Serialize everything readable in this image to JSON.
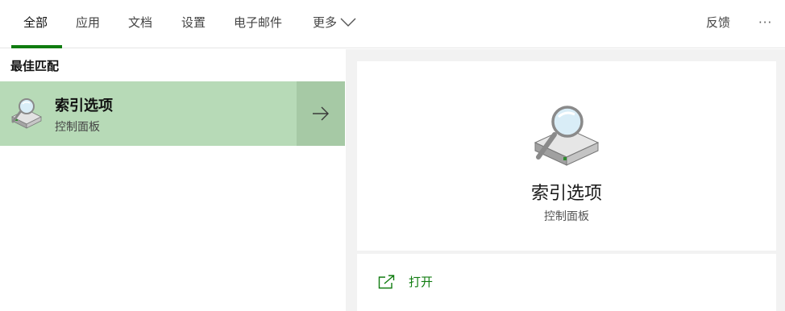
{
  "tabs": [
    {
      "label": "全部",
      "active": true
    },
    {
      "label": "应用"
    },
    {
      "label": "文档"
    },
    {
      "label": "设置"
    },
    {
      "label": "电子邮件"
    },
    {
      "label": "更多"
    }
  ],
  "header": {
    "feedback_label": "反馈",
    "more_options_label": "···"
  },
  "results": {
    "section_title": "最佳匹配",
    "best_match": {
      "name": "索引选项",
      "category": "控制面板",
      "icon": "indexing-options-icon"
    }
  },
  "preview": {
    "title": "索引选项",
    "subtitle": "控制面板",
    "icon": "indexing-options-icon",
    "actions": [
      {
        "label": "打开",
        "icon": "open-icon"
      }
    ]
  },
  "colors": {
    "accent": "#107c10",
    "selected_bg": "#b7dab7",
    "arrow_bg": "#a6c9a5",
    "preview_bg": "#f2f2f2"
  }
}
